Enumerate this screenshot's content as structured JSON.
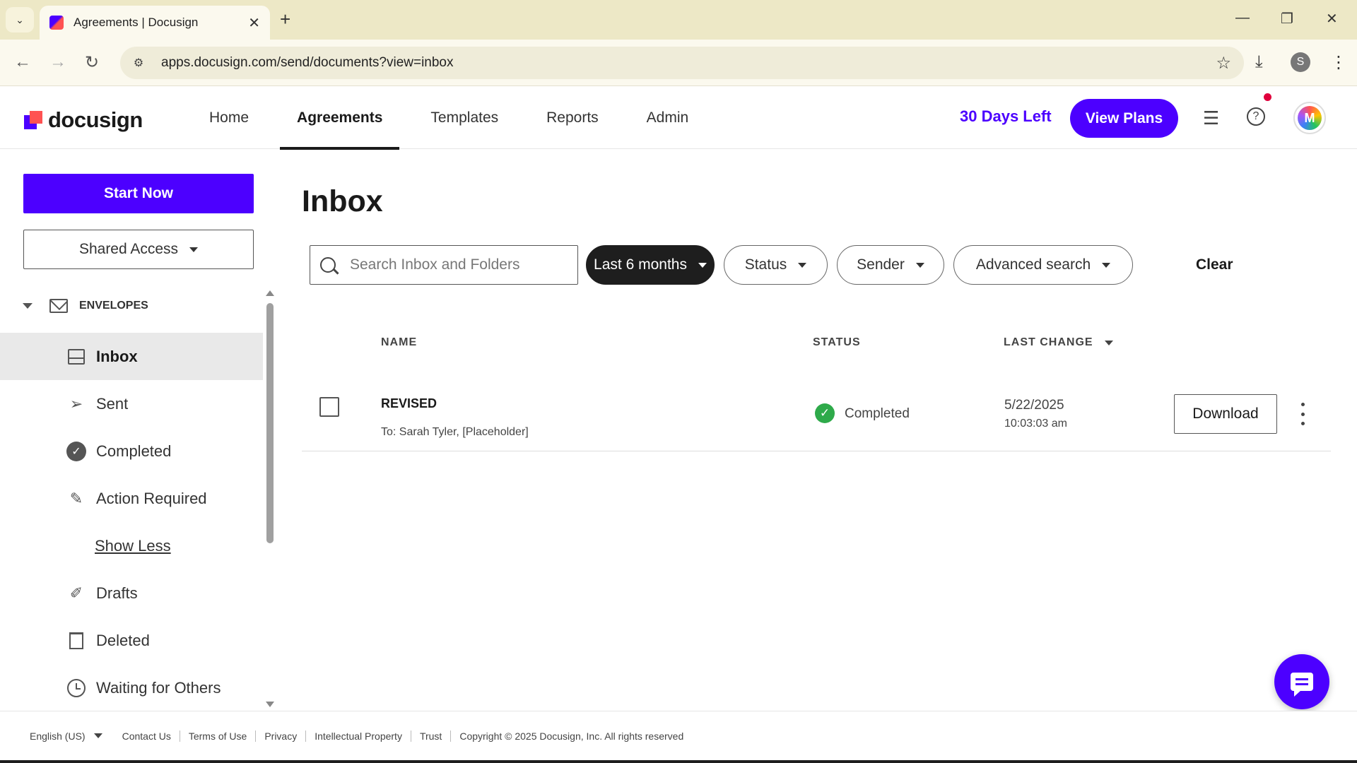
{
  "browser": {
    "tab_title": "Agreements | Docusign",
    "url": "apps.docusign.com/send/documents?view=inbox",
    "profile_initial": "S"
  },
  "header": {
    "logo_text": "docusign",
    "nav": [
      "Home",
      "Agreements",
      "Templates",
      "Reports",
      "Admin"
    ],
    "active_nav": "Agreements",
    "days_left": "30 Days Left",
    "view_plans": "View Plans",
    "avatar_initial": "M"
  },
  "sidebar": {
    "start_now": "Start Now",
    "shared_access": "Shared Access",
    "envelopes_label": "ENVELOPES",
    "items": [
      {
        "label": "Inbox",
        "icon": "inbox-icon",
        "active": true
      },
      {
        "label": "Sent",
        "icon": "send-icon"
      },
      {
        "label": "Completed",
        "icon": "check-circle-icon"
      },
      {
        "label": "Action Required",
        "icon": "pen-icon"
      },
      {
        "label": "Show Less",
        "icon": "",
        "link": true
      },
      {
        "label": "Drafts",
        "icon": "draft-icon"
      },
      {
        "label": "Deleted",
        "icon": "trash-icon"
      },
      {
        "label": "Waiting for Others",
        "icon": "clock-icon"
      }
    ]
  },
  "main": {
    "title": "Inbox",
    "search_placeholder": "Search Inbox and Folders",
    "filters": {
      "date": "Last 6 months",
      "status": "Status",
      "sender": "Sender",
      "advanced": "Advanced search",
      "clear": "Clear"
    },
    "columns": {
      "name": "NAME",
      "status": "STATUS",
      "last_change": "LAST CHANGE"
    },
    "rows": [
      {
        "name": "REVISED",
        "to": "To: Sarah Tyler, [Placeholder]",
        "status": "Completed",
        "date": "5/22/2025",
        "time": "10:03:03 am",
        "action": "Download"
      }
    ]
  },
  "footer": {
    "language": "English (US)",
    "links": [
      "Contact Us",
      "Terms of Use",
      "Privacy",
      "Intellectual Property",
      "Trust"
    ],
    "copyright": "Copyright © 2025 Docusign, Inc. All rights reserved"
  },
  "colors": {
    "brand_primary": "#4c00ff",
    "status_complete": "#2eaa4a",
    "notification": "#e0003c"
  }
}
